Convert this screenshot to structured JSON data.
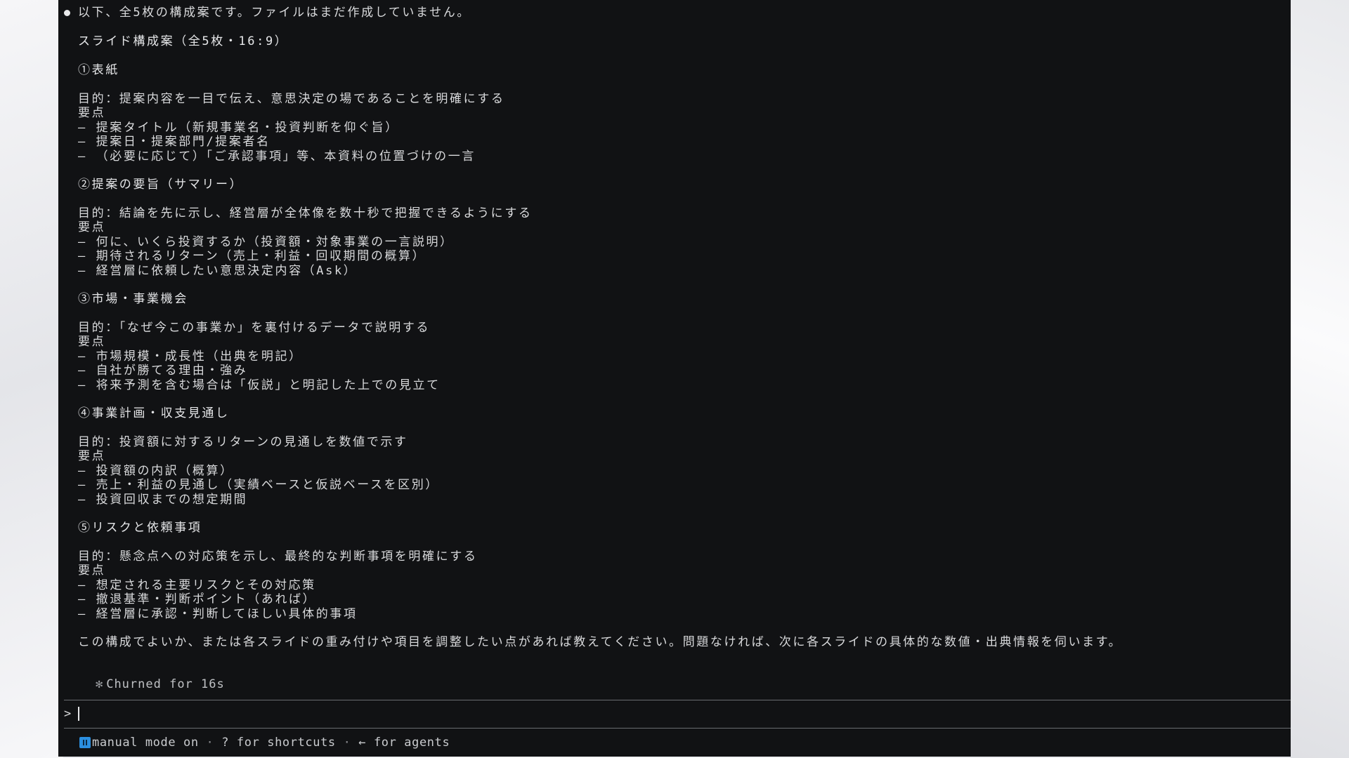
{
  "response": {
    "intro": "以下、全5枚の構成案です。ファイルはまだ作成していません。",
    "heading": "スライド構成案（全5枚・16:9）",
    "slides": [
      {
        "title": "①表紙",
        "purpose": "目的：提案内容を一目で伝え、意思決定の場であることを明確にする",
        "points_label": "要点",
        "points": [
          "– 提案タイトル（新規事業名・投資判断を仰ぐ旨）",
          "– 提案日・提案部門/提案者名",
          "– （必要に応じて）「ご承認事項」等、本資料の位置づけの一言"
        ]
      },
      {
        "title": "②提案の要旨（サマリー）",
        "purpose": "目的：結論を先に示し、経営層が全体像を数十秒で把握できるようにする",
        "points_label": "要点",
        "points": [
          "– 何に、いくら投資するか（投資額・対象事業の一言説明）",
          "– 期待されるリターン（売上・利益・回収期間の概算）",
          "– 経営層に依頼したい意思決定内容（Ask）"
        ]
      },
      {
        "title": "③市場・事業機会",
        "purpose": "目的：「なぜ今この事業か」を裏付けるデータで説明する",
        "points_label": "要点",
        "points": [
          "– 市場規模・成長性（出典を明記）",
          "– 自社が勝てる理由・強み",
          "– 将来予測を含む場合は「仮説」と明記した上での見立て"
        ]
      },
      {
        "title": "④事業計画・収支見通し",
        "purpose": "目的：投資額に対するリターンの見通しを数値で示す",
        "points_label": "要点",
        "points": [
          "– 投資額の内訳（概算）",
          "– 売上・利益の見通し（実績ベースと仮説ベースを区別）",
          "– 投資回収までの想定期間"
        ]
      },
      {
        "title": "⑤リスクと依頼事項",
        "purpose": "目的：懸念点への対応策を示し、最終的な判断事項を明確にする",
        "points_label": "要点",
        "points": [
          "– 想定される主要リスクとその対応策",
          "– 撤退基準・判断ポイント（あれば）",
          "– 経営層に承認・判断してほしい具体的事項"
        ]
      }
    ],
    "closing": "この構成でよいか、または各スライドの重み付けや項目を調整したい点があれば教えてください。問題なければ、次に各スライドの具体的な数値・出典情報を伺います。"
  },
  "status": {
    "icon": "asterisk-icon",
    "text": "Churned for 16s"
  },
  "prompt": {
    "symbol": ">",
    "value": ""
  },
  "footer": {
    "mode_icon": "pause-icon",
    "mode_color": "#2b8fe0",
    "mode_text": "manual mode on",
    "separator": "·",
    "shortcuts_text": "? for shortcuts",
    "agents_text": "← for agents"
  }
}
